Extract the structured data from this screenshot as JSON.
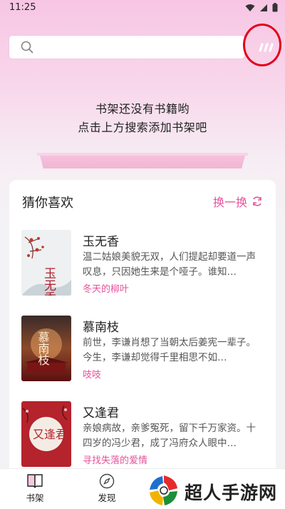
{
  "status_bar": {
    "time": "11:25"
  },
  "search": {
    "placeholder": ""
  },
  "empty_shelf": {
    "line1": "书架还没有书籍哟",
    "line2": "点击上方搜索添加书架吧"
  },
  "recommend": {
    "title": "猜你喜欢",
    "refresh_label": "换一换",
    "books": [
      {
        "title": "玉无香",
        "desc": "温二姑娘美貌无双，人们提起却要道一声叹息，只因她生来是个哑子。谁知…",
        "author": "冬天的柳叶",
        "cover_text": "玉无香"
      },
      {
        "title": "慕南枝",
        "desc": "前世，李谦肖想了当朝太后姜宪一辈子。今生，李谦却觉得千里相思不如…",
        "author": "吱吱",
        "cover_text": "慕南枝"
      },
      {
        "title": "又逢君",
        "desc": "亲娘病故，亲爹冤死，留下千万家资。十四岁的冯少君，成了冯府众人眼中…",
        "author": "寻找失落的爱情",
        "cover_text": "又逢君"
      }
    ]
  },
  "tabs": [
    {
      "label": "书架",
      "icon": "book-icon"
    },
    {
      "label": "发现",
      "icon": "compass-icon"
    }
  ],
  "watermark": {
    "text": "超人手游网"
  },
  "colors": {
    "accent": "#e6539b",
    "highlight_circle": "#e3001b"
  }
}
